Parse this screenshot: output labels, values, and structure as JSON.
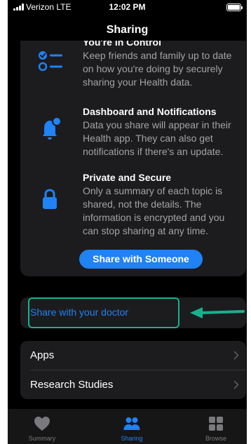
{
  "status_bar": {
    "carrier": "Verizon  LTE",
    "time": "12:02 PM"
  },
  "nav": {
    "title": "Sharing"
  },
  "features": [
    {
      "icon": "checklist-icon",
      "title": "You're in Control",
      "description": "Keep friends and family up to date on how you're doing by securely sharing your Health data."
    },
    {
      "icon": "bell-icon",
      "title": "Dashboard and Notifications",
      "description": "Data you share will appear in their Health app. They can also get notifications if there's an update."
    },
    {
      "icon": "lock-icon",
      "title": "Private and Secure",
      "description": "Only a summary of each topic is shared, not the details. The information is encrypted and you can stop sharing at any time."
    }
  ],
  "share_button_label": "Share with Someone",
  "doctor_row_label": "Share with your doctor",
  "list_items": [
    {
      "label": "Apps"
    },
    {
      "label": "Research Studies"
    }
  ],
  "tabs": [
    {
      "label": "Summary",
      "icon": "heart-icon",
      "active": false
    },
    {
      "label": "Sharing",
      "icon": "people-icon",
      "active": true
    },
    {
      "label": "Browse",
      "icon": "grid-icon",
      "active": false
    }
  ],
  "colors": {
    "accent": "#1f82f5",
    "highlight": "#17b28d",
    "background": "#000000",
    "card": "#1c1c1e",
    "inactive_tab": "#7a7a7e"
  }
}
